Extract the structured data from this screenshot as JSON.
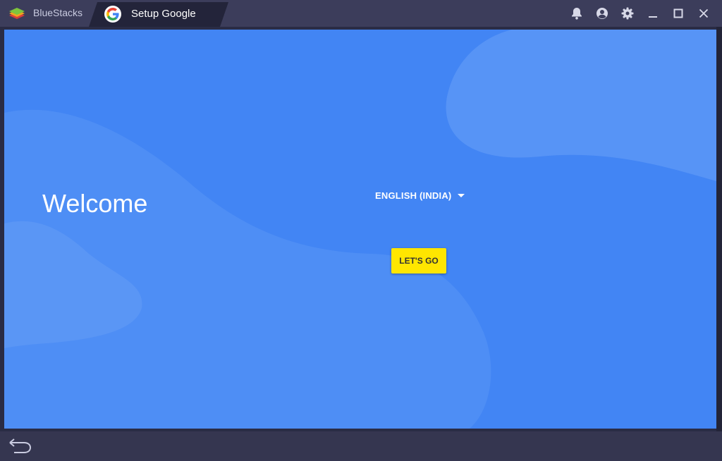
{
  "titlebar": {
    "app_name": "BlueStacks",
    "tab_title": "Setup Google",
    "controls": [
      "bell-icon",
      "account-icon",
      "gear-icon",
      "minimize-icon",
      "maximize-icon",
      "close-icon"
    ]
  },
  "screen": {
    "welcome": "Welcome",
    "language": "ENGLISH (INDIA)",
    "go_button": "LET'S GO"
  },
  "colors": {
    "screen_bg": "#4285f4",
    "button_bg": "#ffe600",
    "titlebar_bg": "#3c3d5b"
  }
}
